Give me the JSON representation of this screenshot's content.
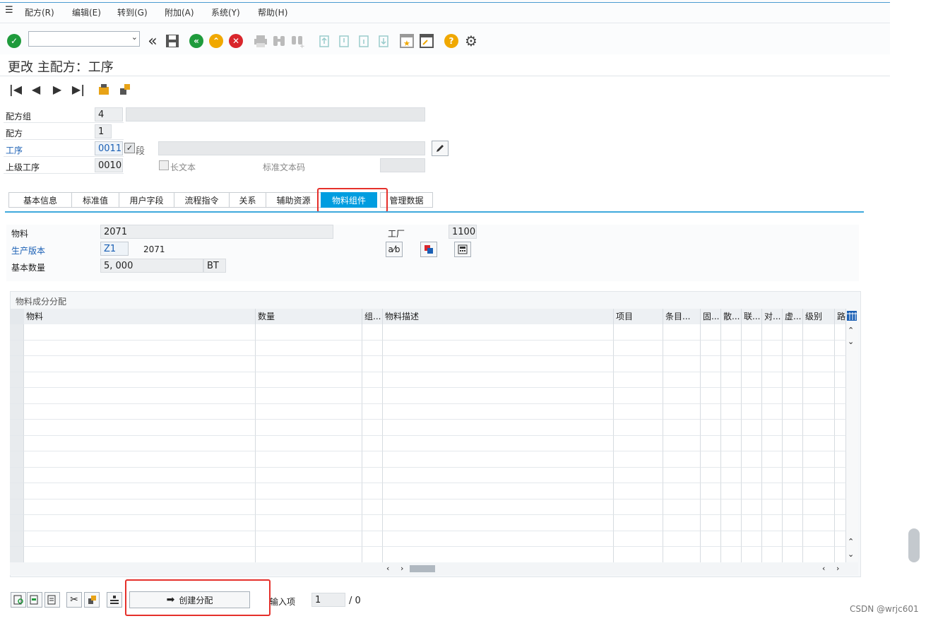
{
  "menu": [
    "配方(R)",
    "编辑(E)",
    "转到(G)",
    "附加(A)",
    "系统(Y)",
    "帮助(H)"
  ],
  "title": "更改 主配方：工序",
  "header_fields": {
    "recipe_group_label": "配方组",
    "recipe_group_value": "4",
    "recipe_label": "配方",
    "recipe_value": "1",
    "operation_label": "工序",
    "operation_value": "0011",
    "phase_label": "段",
    "parent_op_label": "上级工序",
    "parent_op_value": "0010",
    "long_text_label": "长文本",
    "std_text_label": "标准文本码"
  },
  "tabs": [
    "基本信息",
    "标准值",
    "用户字段",
    "流程指令",
    "关系",
    "辅助资源",
    "物料组件",
    "管理数据"
  ],
  "active_tab": "物料组件",
  "material_section": {
    "material_label": "物料",
    "material_value": "2071",
    "plant_label": "工厂",
    "plant_value": "1100",
    "version_label": "生产版本",
    "version_value": "Z1",
    "version_text": "2071",
    "base_qty_label": "基本数量",
    "base_qty_value": "5, 000",
    "base_qty_unit": "BT"
  },
  "grid": {
    "title": "物料成分分配",
    "columns": [
      "物料",
      "数量",
      "组...",
      "物料描述",
      "项目",
      "条目...",
      "固...",
      "散...",
      "联...",
      "对...",
      "虚...",
      "级别",
      "路"
    ]
  },
  "bottom": {
    "create_button": "创建分配",
    "entry_label": "输入项",
    "entry_value": "1",
    "entry_total": "/ 0"
  },
  "watermark": "CSDN @wrjc601",
  "colors": {
    "accent": "#009de0",
    "highlight": "#e5302b"
  }
}
